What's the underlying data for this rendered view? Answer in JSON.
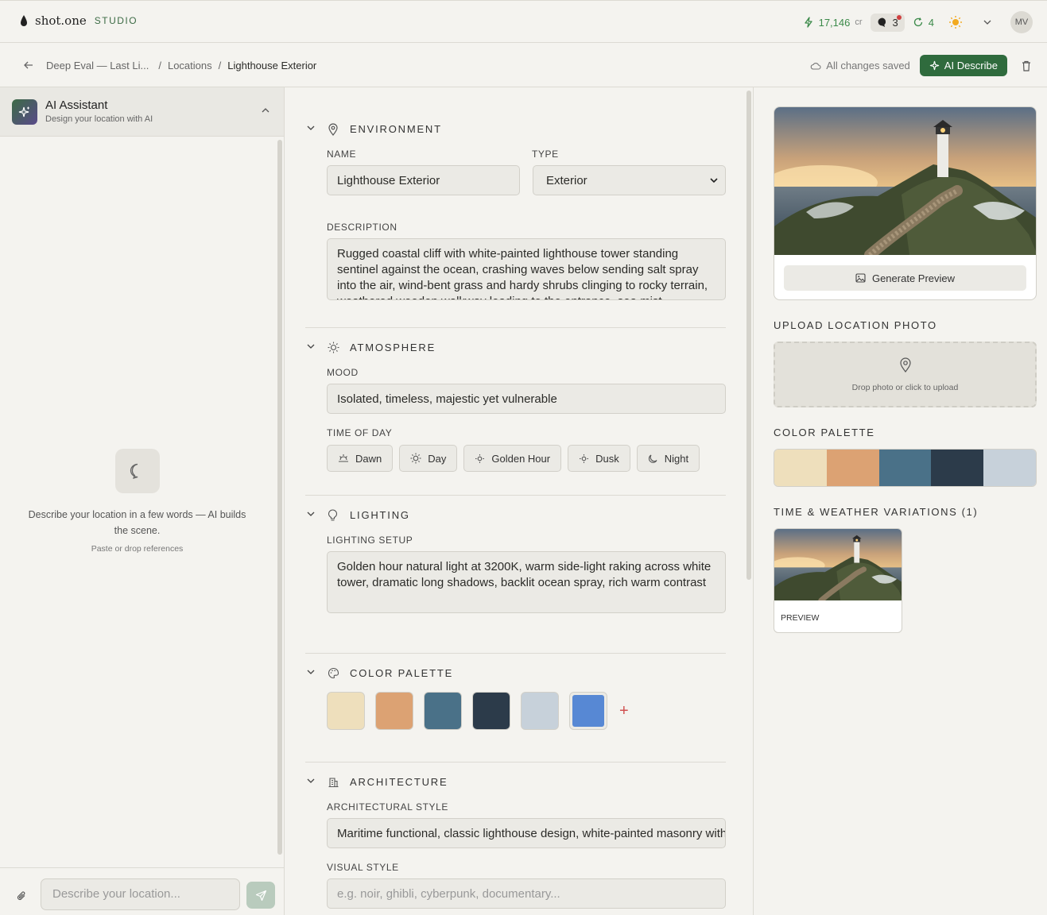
{
  "app": {
    "brand": "shot.one",
    "studio": "STUDIO"
  },
  "top": {
    "credits": "17,146",
    "credits_unit": "cr",
    "messages": "3",
    "sync_count": "4",
    "avatar": "MV"
  },
  "breadcrumb": {
    "project": "Deep Eval — Last Li...",
    "section": "Locations",
    "current": "Lighthouse Exterior"
  },
  "status": {
    "saved": "All changes saved",
    "ai_describe": "AI Describe"
  },
  "assistant": {
    "title": "AI Assistant",
    "subtitle": "Design your location with AI",
    "empty_text": "Describe your location in a few words — AI builds the scene.",
    "empty_hint": "Paste or drop references",
    "input_placeholder": "Describe your location..."
  },
  "environment": {
    "heading": "ENVIRONMENT",
    "name_label": "NAME",
    "name_value": "Lighthouse Exterior",
    "type_label": "TYPE",
    "type_value": "Exterior",
    "description_label": "DESCRIPTION",
    "description_value": "Rugged coastal cliff with white-painted lighthouse tower standing sentinel against the ocean, crashing waves below sending salt spray into the air, wind-bent grass and hardy shrubs clinging to rocky terrain, weathered wooden walkway leading to the entrance, sea mist"
  },
  "atmosphere": {
    "heading": "ATMOSPHERE",
    "mood_label": "MOOD",
    "mood_value": "Isolated, timeless, majestic yet vulnerable",
    "tod_label": "TIME OF DAY",
    "tod": [
      "Dawn",
      "Day",
      "Golden Hour",
      "Dusk",
      "Night"
    ]
  },
  "lighting": {
    "heading": "LIGHTING",
    "setup_label": "LIGHTING SETUP",
    "setup_value": "Golden hour natural light at 3200K, warm side-light raking across white tower, dramatic long shadows, backlit ocean spray, rich warm contrast"
  },
  "palette": {
    "heading": "COLOR PALETTE",
    "colors": [
      "#EEDFBC",
      "#DCA273",
      "#4A7188",
      "#2C3B4A",
      "#C7D1DA"
    ],
    "selected": "#5788D4"
  },
  "architecture": {
    "heading": "ARCHITECTURE",
    "style_label": "ARCHITECTURAL STYLE",
    "style_value": "Maritime functional, classic lighthouse design, white-painted masonry with",
    "visual_label": "VISUAL STYLE",
    "visual_placeholder": "e.g. noir, ghibli, cyberpunk, documentary..."
  },
  "right": {
    "generate": "Generate Preview",
    "upload_heading": "UPLOAD LOCATION PHOTO",
    "upload_text": "Drop photo or click to upload",
    "palette_heading": "COLOR PALETTE",
    "variations_heading": "TIME & WEATHER VARIATIONS (1)",
    "variation_label": "PREVIEW"
  }
}
